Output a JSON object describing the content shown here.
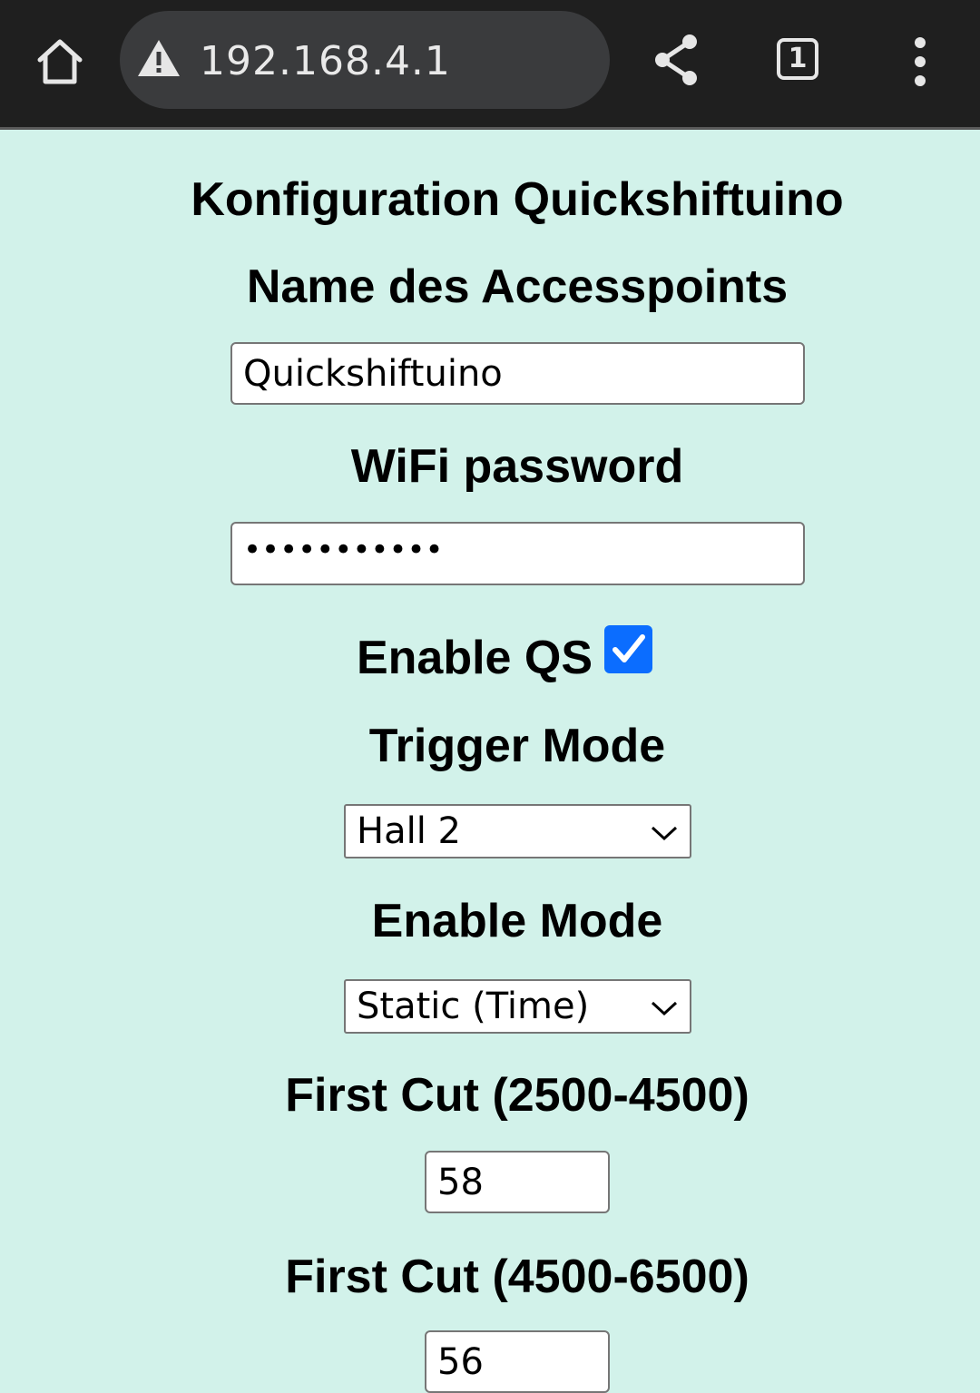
{
  "browser": {
    "url": "192.168.4.1",
    "tab_count": "1",
    "icons": [
      "home-icon",
      "warning-icon",
      "share-icon",
      "tabs-icon",
      "more-vert-icon"
    ]
  },
  "page": {
    "title": "Konfiguration Quickshiftuino",
    "ap_name_label": "Name des Accesspoints",
    "ap_name_value": "Quickshiftuino",
    "wifi_password_label": "WiFi password",
    "wifi_password_mask": "•••••••••••",
    "enable_qs_label": "Enable QS",
    "enable_qs_checked": true,
    "trigger_mode_label": "Trigger Mode",
    "trigger_mode_value": "Hall 2",
    "enable_mode_label": "Enable Mode",
    "enable_mode_value": "Static (Time)",
    "first_cut_1_label": "First Cut (2500-4500)",
    "first_cut_1_value": "58",
    "first_cut_2_label": "First Cut (4500-6500)",
    "first_cut_2_value": "56"
  },
  "colors": {
    "page_background": "#d2f2ea",
    "browser_bar": "#1f1f1f",
    "url_field": "#3a3b3d",
    "checkbox_accent": "#0b6dff"
  }
}
